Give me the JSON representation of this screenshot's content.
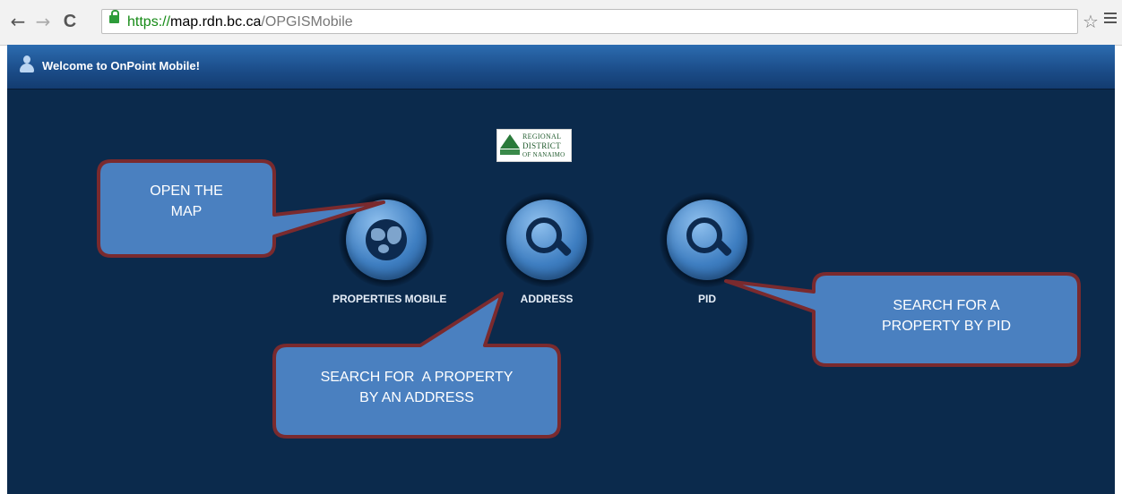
{
  "browser": {
    "url_scheme": "https://",
    "url_host": "map.rdn.bc.ca",
    "url_path": "/OPGISMobile",
    "back_glyph": "←",
    "forward_glyph": "→",
    "reload_glyph": "C",
    "star_glyph": "☆"
  },
  "header": {
    "welcome": "Welcome to OnPoint Mobile!"
  },
  "logo": {
    "line1": "REGIONAL",
    "line2": "DISTRICT",
    "line3": "OF NANAIMO"
  },
  "tools": [
    {
      "label": "PROPERTIES MOBILE",
      "icon": "globe-icon"
    },
    {
      "label": "ADDRESS",
      "icon": "search-icon"
    },
    {
      "label": "PID",
      "icon": "search-icon"
    }
  ],
  "callouts": {
    "open_map": {
      "line1": "OPEN THE",
      "line2": "MAP"
    },
    "address": {
      "line1": "SEARCH FOR  A PROPERTY",
      "line2": "BY AN ADDRESS"
    },
    "pid": {
      "line1": "SEARCH FOR A",
      "line2": "PROPERTY BY PID"
    }
  },
  "colors": {
    "app_background": "#0b2a4c",
    "header": "#1b4c88",
    "callout_fill": "#4a80c0",
    "callout_border": "#7a2a2e"
  }
}
